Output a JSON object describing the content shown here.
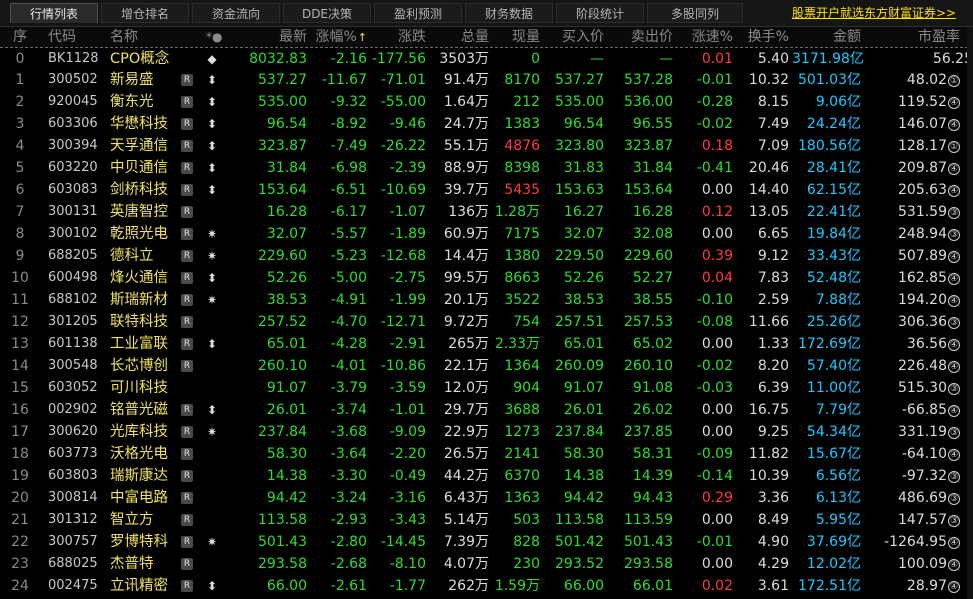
{
  "tabs": [
    {
      "label": "行情列表",
      "active": true
    },
    {
      "label": "增仓排名",
      "active": false
    },
    {
      "label": "资金流向",
      "active": false
    },
    {
      "label": "DDE决策",
      "active": false
    },
    {
      "label": "盈利预测",
      "active": false
    },
    {
      "label": "财务数据",
      "active": false
    },
    {
      "label": "阶段统计",
      "active": false
    },
    {
      "label": "多股同列",
      "active": false
    }
  ],
  "promo_link": "股票开户就选东方财富证券>>",
  "columns": {
    "idx": "序",
    "code": "代码",
    "name": "名称",
    "mark": "*●",
    "price": "最新",
    "chg_pct": "涨幅%",
    "change": "涨跌",
    "volume": "总量",
    "now_vol": "现量",
    "bid": "买入价",
    "ask": "卖出价",
    "speed": "涨速%",
    "turnover": "换手%",
    "amount": "金额",
    "pe": "市盈率"
  },
  "sort": {
    "column": "chg_pct",
    "direction": "desc",
    "arrow": "↑"
  },
  "colors": {
    "up": "#ff3b3b",
    "down": "#2fdc2f",
    "amount": "#1ec8ff",
    "name": "#f2e25c"
  },
  "rows": [
    {
      "idx": "0",
      "code": "BK1128",
      "name": "CPO概念",
      "badge": "",
      "mark": "◆",
      "price": "8032.83",
      "chg_pct": "-2.16",
      "change": "-177.56",
      "volume": "3503万",
      "now_vol": "0",
      "bid": "—",
      "ask": "—",
      "speed": "0.01",
      "turnover": "5.40",
      "amount": "3171.98亿",
      "pe": "56.25",
      "pe_rank": ""
    },
    {
      "idx": "1",
      "code": "300502",
      "name": "新易盛",
      "badge": "R",
      "mark": "⬍",
      "price": "537.27",
      "chg_pct": "-11.67",
      "change": "-71.01",
      "volume": "91.4万",
      "now_vol": "8170",
      "bid": "537.27",
      "ask": "537.28",
      "speed": "-0.01",
      "turnover": "10.32",
      "amount": "501.03亿",
      "pe": "48.02",
      "pe_rank": "①"
    },
    {
      "idx": "2",
      "code": "920045",
      "name": "衡东光",
      "badge": "R",
      "mark": "⬍",
      "price": "535.00",
      "chg_pct": "-9.32",
      "change": "-55.00",
      "volume": "1.64万",
      "now_vol": "212",
      "bid": "535.00",
      "ask": "536.00",
      "speed": "-0.28",
      "turnover": "8.15",
      "amount": "9.06亿",
      "pe": "119.52",
      "pe_rank": "④"
    },
    {
      "idx": "3",
      "code": "603306",
      "name": "华懋科技",
      "badge": "R",
      "mark": "⬍",
      "price": "96.54",
      "chg_pct": "-8.92",
      "change": "-9.46",
      "volume": "24.7万",
      "now_vol": "1383",
      "bid": "96.54",
      "ask": "96.55",
      "speed": "-0.02",
      "turnover": "7.49",
      "amount": "24.24亿",
      "pe": "146.07",
      "pe_rank": "④"
    },
    {
      "idx": "4",
      "code": "300394",
      "name": "天孚通信",
      "badge": "R",
      "mark": "⬍",
      "price": "323.87",
      "chg_pct": "-7.49",
      "change": "-26.22",
      "volume": "55.1万",
      "now_vol": "4876",
      "bid": "323.80",
      "ask": "323.87",
      "speed": "0.18",
      "turnover": "7.09",
      "amount": "180.56亿",
      "pe": "128.17",
      "pe_rank": "①"
    },
    {
      "idx": "5",
      "code": "603220",
      "name": "中贝通信",
      "badge": "R",
      "mark": "⬍",
      "price": "31.84",
      "chg_pct": "-6.98",
      "change": "-2.39",
      "volume": "88.9万",
      "now_vol": "8398",
      "bid": "31.83",
      "ask": "31.84",
      "speed": "-0.41",
      "turnover": "20.46",
      "amount": "28.41亿",
      "pe": "209.87",
      "pe_rank": "④"
    },
    {
      "idx": "6",
      "code": "603083",
      "name": "剑桥科技",
      "badge": "R",
      "mark": "⬍",
      "price": "153.64",
      "chg_pct": "-6.51",
      "change": "-10.69",
      "volume": "39.7万",
      "now_vol": "5435",
      "bid": "153.63",
      "ask": "153.64",
      "speed": "0.00",
      "turnover": "14.40",
      "amount": "62.15亿",
      "pe": "205.63",
      "pe_rank": "④"
    },
    {
      "idx": "7",
      "code": "300131",
      "name": "英唐智控",
      "badge": "R",
      "mark": "",
      "price": "16.28",
      "chg_pct": "-6.17",
      "change": "-1.07",
      "volume": "136万",
      "now_vol": "1.28万",
      "bid": "16.27",
      "ask": "16.28",
      "speed": "0.12",
      "turnover": "13.05",
      "amount": "22.41亿",
      "pe": "531.59",
      "pe_rank": "③"
    },
    {
      "idx": "8",
      "code": "300102",
      "name": "乾照光电",
      "badge": "R",
      "mark": "✷",
      "price": "32.07",
      "chg_pct": "-5.57",
      "change": "-1.89",
      "volume": "60.9万",
      "now_vol": "7175",
      "bid": "32.07",
      "ask": "32.08",
      "speed": "0.00",
      "turnover": "6.65",
      "amount": "19.84亿",
      "pe": "248.94",
      "pe_rank": "③"
    },
    {
      "idx": "9",
      "code": "688205",
      "name": "德科立",
      "badge": "R",
      "mark": "✷",
      "price": "229.60",
      "chg_pct": "-5.23",
      "change": "-12.68",
      "volume": "14.4万",
      "now_vol": "1380",
      "bid": "229.50",
      "ask": "229.60",
      "speed": "0.39",
      "turnover": "9.12",
      "amount": "33.43亿",
      "pe": "507.89",
      "pe_rank": "④"
    },
    {
      "idx": "10",
      "code": "600498",
      "name": "烽火通信",
      "badge": "R",
      "mark": "⬍",
      "price": "52.26",
      "chg_pct": "-5.00",
      "change": "-2.75",
      "volume": "99.5万",
      "now_vol": "8663",
      "bid": "52.26",
      "ask": "52.27",
      "speed": "0.04",
      "turnover": "7.83",
      "amount": "52.48亿",
      "pe": "162.85",
      "pe_rank": "④"
    },
    {
      "idx": "11",
      "code": "688102",
      "name": "斯瑞新材",
      "badge": "R",
      "mark": "✷",
      "price": "38.53",
      "chg_pct": "-4.91",
      "change": "-1.99",
      "volume": "20.1万",
      "now_vol": "3522",
      "bid": "38.53",
      "ask": "38.55",
      "speed": "-0.10",
      "turnover": "2.59",
      "amount": "7.88亿",
      "pe": "194.20",
      "pe_rank": "④"
    },
    {
      "idx": "12",
      "code": "301205",
      "name": "联特科技",
      "badge": "R",
      "mark": "",
      "price": "257.52",
      "chg_pct": "-4.70",
      "change": "-12.71",
      "volume": "9.72万",
      "now_vol": "754",
      "bid": "257.51",
      "ask": "257.53",
      "speed": "-0.08",
      "turnover": "11.66",
      "amount": "25.26亿",
      "pe": "306.36",
      "pe_rank": "③"
    },
    {
      "idx": "13",
      "code": "601138",
      "name": "工业富联",
      "badge": "R",
      "mark": "⬍",
      "price": "65.01",
      "chg_pct": "-4.28",
      "change": "-2.91",
      "volume": "265万",
      "now_vol": "2.33万",
      "bid": "65.01",
      "ask": "65.02",
      "speed": "0.00",
      "turnover": "1.33",
      "amount": "172.69亿",
      "pe": "36.56",
      "pe_rank": "④"
    },
    {
      "idx": "14",
      "code": "300548",
      "name": "长芯博创",
      "badge": "R",
      "mark": "",
      "price": "260.10",
      "chg_pct": "-4.01",
      "change": "-10.86",
      "volume": "22.1万",
      "now_vol": "1364",
      "bid": "260.09",
      "ask": "260.10",
      "speed": "-0.02",
      "turnover": "8.20",
      "amount": "57.40亿",
      "pe": "226.48",
      "pe_rank": "④"
    },
    {
      "idx": "15",
      "code": "603052",
      "name": "可川科技",
      "badge": "",
      "mark": "",
      "price": "91.07",
      "chg_pct": "-3.79",
      "change": "-3.59",
      "volume": "12.0万",
      "now_vol": "904",
      "bid": "91.07",
      "ask": "91.08",
      "speed": "-0.03",
      "turnover": "6.39",
      "amount": "11.00亿",
      "pe": "515.30",
      "pe_rank": "③"
    },
    {
      "idx": "16",
      "code": "002902",
      "name": "铭普光磁",
      "badge": "R",
      "mark": "⬍",
      "price": "26.01",
      "chg_pct": "-3.74",
      "change": "-1.01",
      "volume": "29.7万",
      "now_vol": "3688",
      "bid": "26.01",
      "ask": "26.02",
      "speed": "0.00",
      "turnover": "16.75",
      "amount": "7.79亿",
      "pe": "-66.85",
      "pe_rank": "④"
    },
    {
      "idx": "17",
      "code": "300620",
      "name": "光库科技",
      "badge": "R",
      "mark": "✷",
      "price": "237.84",
      "chg_pct": "-3.68",
      "change": "-9.09",
      "volume": "22.9万",
      "now_vol": "1273",
      "bid": "237.84",
      "ask": "237.85",
      "speed": "0.00",
      "turnover": "9.25",
      "amount": "54.34亿",
      "pe": "331.19",
      "pe_rank": "③"
    },
    {
      "idx": "18",
      "code": "603773",
      "name": "沃格光电",
      "badge": "R",
      "mark": "",
      "price": "58.30",
      "chg_pct": "-3.64",
      "change": "-2.20",
      "volume": "26.5万",
      "now_vol": "2141",
      "bid": "58.30",
      "ask": "58.31",
      "speed": "-0.09",
      "turnover": "11.82",
      "amount": "15.67亿",
      "pe": "-64.10",
      "pe_rank": "④"
    },
    {
      "idx": "19",
      "code": "603803",
      "name": "瑞斯康达",
      "badge": "R",
      "mark": "",
      "price": "14.38",
      "chg_pct": "-3.30",
      "change": "-0.49",
      "volume": "44.2万",
      "now_vol": "6370",
      "bid": "14.38",
      "ask": "14.39",
      "speed": "-0.14",
      "turnover": "10.39",
      "amount": "6.56亿",
      "pe": "-97.32",
      "pe_rank": "③"
    },
    {
      "idx": "20",
      "code": "300814",
      "name": "中富电路",
      "badge": "R",
      "mark": "",
      "price": "94.42",
      "chg_pct": "-3.24",
      "change": "-3.16",
      "volume": "6.43万",
      "now_vol": "1363",
      "bid": "94.42",
      "ask": "94.43",
      "speed": "0.29",
      "turnover": "3.36",
      "amount": "6.13亿",
      "pe": "486.69",
      "pe_rank": "③"
    },
    {
      "idx": "21",
      "code": "301312",
      "name": "智立方",
      "badge": "R",
      "mark": "",
      "price": "113.58",
      "chg_pct": "-2.93",
      "change": "-3.43",
      "volume": "5.14万",
      "now_vol": "503",
      "bid": "113.58",
      "ask": "113.59",
      "speed": "0.00",
      "turnover": "8.49",
      "amount": "5.95亿",
      "pe": "147.57",
      "pe_rank": "③"
    },
    {
      "idx": "22",
      "code": "300757",
      "name": "罗博特科",
      "badge": "R",
      "mark": "✷",
      "price": "501.43",
      "chg_pct": "-2.80",
      "change": "-14.45",
      "volume": "7.39万",
      "now_vol": "828",
      "bid": "501.42",
      "ask": "501.43",
      "speed": "-0.01",
      "turnover": "4.90",
      "amount": "37.69亿",
      "pe": "-1264.95",
      "pe_rank": "④"
    },
    {
      "idx": "23",
      "code": "688025",
      "name": "杰普特",
      "badge": "R",
      "mark": "",
      "price": "293.58",
      "chg_pct": "-2.68",
      "change": "-8.10",
      "volume": "4.07万",
      "now_vol": "230",
      "bid": "293.52",
      "ask": "293.58",
      "speed": "0.00",
      "turnover": "4.29",
      "amount": "12.02亿",
      "pe": "100.09",
      "pe_rank": "④"
    },
    {
      "idx": "24",
      "code": "002475",
      "name": "立讯精密",
      "badge": "R",
      "mark": "⬍",
      "price": "66.00",
      "chg_pct": "-2.61",
      "change": "-1.77",
      "volume": "262万",
      "now_vol": "1.59万",
      "bid": "66.00",
      "ask": "66.01",
      "speed": "0.02",
      "turnover": "3.61",
      "amount": "172.51亿",
      "pe": "28.97",
      "pe_rank": "④"
    }
  ]
}
